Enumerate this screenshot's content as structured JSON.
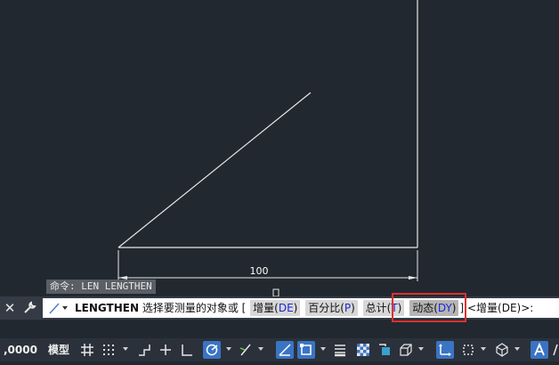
{
  "drawing": {
    "dimension_text": "100"
  },
  "command_history": "命令: LEN LENGTHEN",
  "commandline": {
    "close_icon": "close-icon",
    "customize_icon": "wrench-icon",
    "command_name": "LENGTHEN",
    "prompt": "选择要测量的对象或 [",
    "options": [
      {
        "label": "增量(",
        "key": "DE",
        "end": ")"
      },
      {
        "label": "百分比(",
        "key": "P",
        "end": ")"
      },
      {
        "label": "总计(",
        "key": "T",
        "end": ")"
      },
      {
        "label": "动态(",
        "key": "DY",
        "end": ")"
      }
    ],
    "bracket_close": "]",
    "default": "<增量(DE)>:"
  },
  "highlight_color": "#e03030",
  "statusbar": {
    "coordinates": ",0000",
    "coord_prefix": ",",
    "coord_value": "0000",
    "model_label": "模型",
    "accent": "#3a74c4",
    "tools": [
      "grid-icon",
      "snap-icon",
      "infer-icon",
      "ortho-icon",
      "polar-icon",
      "isometric-icon",
      "object-track-icon",
      "osnap-icon",
      "lineweight-icon",
      "transparency-icon",
      "selection-cycle-icon",
      "3d-osnap-icon",
      "dynamic-ucs-icon",
      "annotation-icon",
      "workspace-icon"
    ]
  }
}
